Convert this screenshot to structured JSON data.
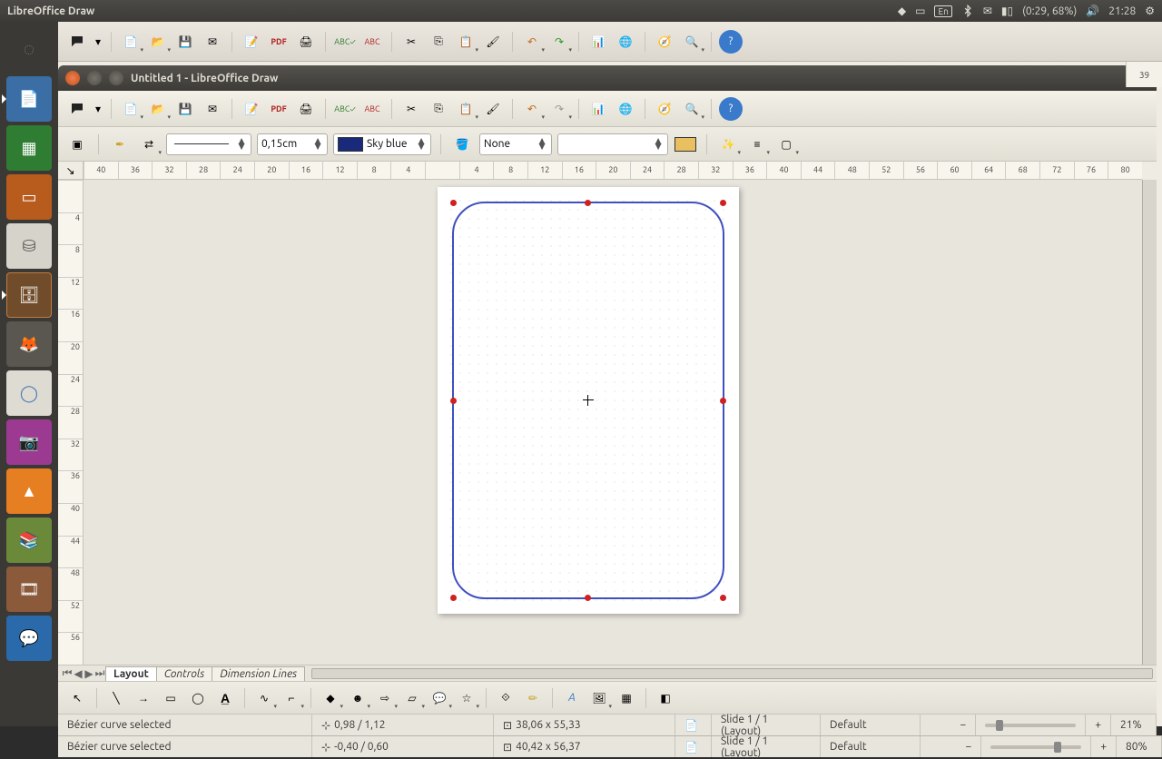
{
  "menubar": {
    "app_title": "LibreOffice Draw",
    "lang": "En",
    "battery": "(0:29, 68%)",
    "time": "21:28"
  },
  "window": {
    "title": "Untitled 1 - LibreOffice Draw"
  },
  "style": {
    "line_width": "0,15cm",
    "line_color_name": "Sky blue",
    "fill_style": "None",
    "fill_pattern": ""
  },
  "ruler_h": [
    "40",
    "36",
    "32",
    "28",
    "24",
    "20",
    "16",
    "12",
    "8",
    "4",
    "",
    "4",
    "8",
    "12",
    "16",
    "20",
    "24",
    "28",
    "32",
    "36",
    "40",
    "44",
    "48",
    "52",
    "56",
    "60",
    "64",
    "68",
    "72",
    "76",
    "80"
  ],
  "ruler_v": [
    "",
    "4",
    "8",
    "12",
    "16",
    "20",
    "24",
    "28",
    "32",
    "36",
    "40",
    "44",
    "48",
    "52",
    "56"
  ],
  "tabs": {
    "layout": "Layout",
    "controls": "Controls",
    "dimlines": "Dimension Lines"
  },
  "status1": {
    "selection": "Bézier curve selected",
    "pos": "0,98 / 1,12",
    "size": "38,06 x 55,33",
    "slide": "Slide 1 / 1 (Layout)",
    "style": "Default",
    "zoom": "21%"
  },
  "status2": {
    "selection": "Bézier curve selected",
    "pos": "-0,40 / 0,60",
    "size": "40,42 x 56,37",
    "slide": "Slide 1 / 1 (Layout)",
    "style": "Default",
    "zoom": "80%"
  },
  "side_number": "39"
}
